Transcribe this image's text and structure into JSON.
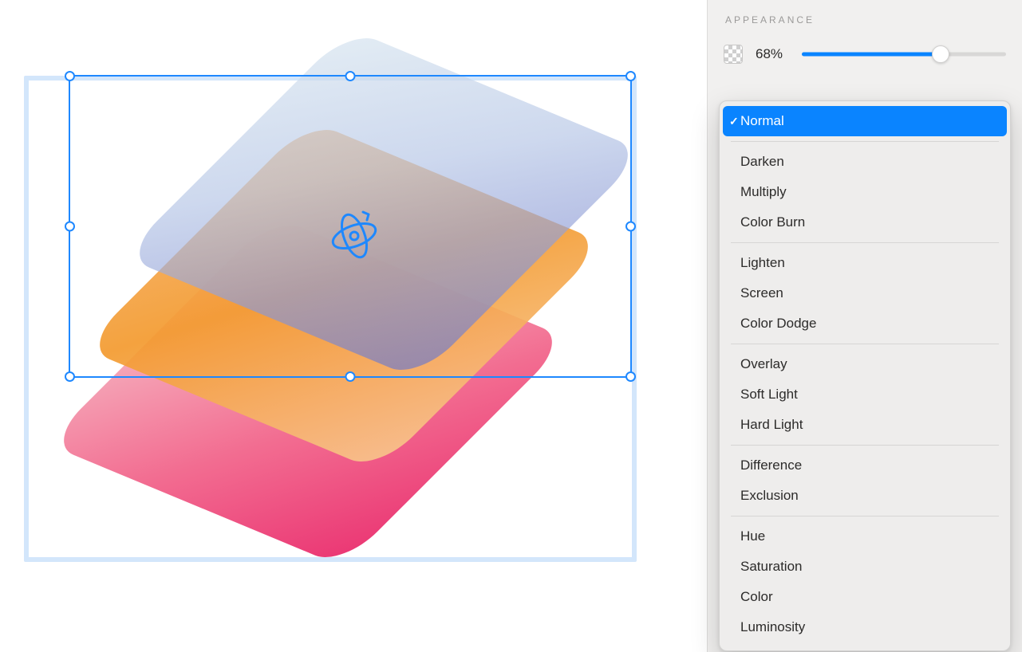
{
  "inspector": {
    "section_title": "APPEARANCE",
    "opacity": {
      "value_label": "68%",
      "percent": 68
    },
    "blend_modes": {
      "selected": "Normal",
      "groups": [
        [
          "Normal"
        ],
        [
          "Darken",
          "Multiply",
          "Color Burn"
        ],
        [
          "Lighten",
          "Screen",
          "Color Dodge"
        ],
        [
          "Overlay",
          "Soft Light",
          "Hard Light"
        ],
        [
          "Difference",
          "Exclusion"
        ],
        [
          "Hue",
          "Saturation",
          "Color",
          "Luminosity"
        ]
      ]
    }
  },
  "canvas": {
    "layers": [
      "pink-layer",
      "orange-layer",
      "blue-layer"
    ],
    "rotate_icon": "rotate-3d-icon"
  }
}
